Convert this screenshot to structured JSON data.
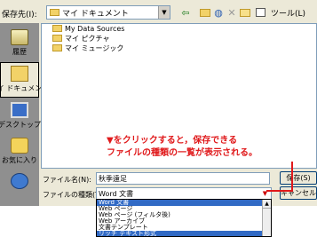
{
  "toolbar": {
    "location_label": "保存先(I):",
    "location_value": "マイ ドキュメント",
    "back_glyph": "⇦",
    "up_glyph": "",
    "globe_glyph": "◍",
    "delete_glyph": "✕",
    "tools_label": "ツール(L)",
    "arrow_glyph": "▼"
  },
  "places": [
    {
      "label": "履歴",
      "icon": "history-icon"
    },
    {
      "label": "マイ ドキュメント",
      "icon": "my-documents-icon"
    },
    {
      "label": "デスクトップ",
      "icon": "desktop-icon"
    },
    {
      "label": "お気に入り",
      "icon": "favorites-icon"
    },
    {
      "label": "",
      "icon": "network-icon"
    }
  ],
  "files": [
    {
      "name": "My Data Sources"
    },
    {
      "name": "マイ ピクチャ"
    },
    {
      "name": "マイ ミュージック"
    }
  ],
  "filename": {
    "label": "ファイル名(N):",
    "value": "秋季遠足"
  },
  "filetype": {
    "label": "ファイルの種類(T):",
    "value": "Word 文書",
    "options": [
      "Word 文書",
      "Web ページ",
      "Web ページ (フィルタ後)",
      "Web アーカイブ",
      "文書テンプレート",
      "リッチ テキスト形式"
    ]
  },
  "buttons": {
    "save": "保存(S)",
    "cancel": "キャンセル"
  },
  "annotation": {
    "line1": "▼をクリックすると，保存できる",
    "line2": "ファイルの種類の一覧が表示される。",
    "color": "#e0191b"
  }
}
